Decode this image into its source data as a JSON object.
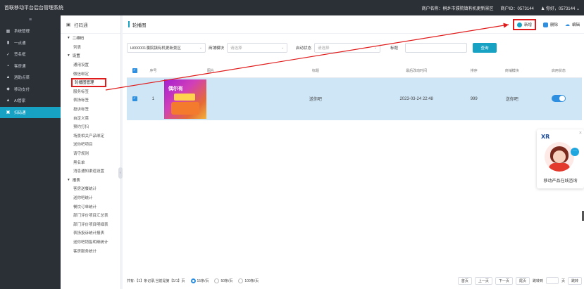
{
  "header": {
    "title": "首联移动平台后台管理系统",
    "merchant_label": "商户名称：桐乡市濮院镇有机更新景区",
    "merchant_id": "商户ID：0573144",
    "greeting": "你好，0573144"
  },
  "sidebar": {
    "toggle": "≡",
    "items": [
      {
        "icon": "grid-icon",
        "glyph": "▦",
        "label": "系统管理"
      },
      {
        "icon": "bar-chart-icon",
        "glyph": "▮",
        "label": "一点通"
      },
      {
        "icon": "pen-icon",
        "glyph": "✓",
        "label": "签名框"
      },
      {
        "icon": "cart-icon",
        "glyph": "▪",
        "label": "客房通"
      },
      {
        "icon": "shop-icon",
        "glyph": "▲",
        "label": "酒助点菜"
      },
      {
        "icon": "pay-icon",
        "glyph": "◆",
        "label": "移动支付"
      },
      {
        "icon": "home-icon",
        "glyph": "▲",
        "label": "AI管家"
      },
      {
        "icon": "scan-icon",
        "glyph": "▣",
        "label": "扫码通"
      }
    ]
  },
  "submenu": {
    "title": "扫码通",
    "groups": [
      {
        "label": "二维码",
        "items": [
          "列表"
        ]
      },
      {
        "label": "设置",
        "items": [
          "通用设置",
          "微信绑定",
          "轮播图管理",
          "服务标签",
          "表扬标签",
          "投诉标签",
          "自定义菜",
          "预约打扫",
          "场景相关产品绑定",
          "送你吧项目",
          "请守规则",
          "黑名单",
          "消息通知渠道设置"
        ]
      },
      {
        "label": "报表",
        "items": [
          "客房送餐统计",
          "送你吧统计",
          "餐饮订单统计",
          "部门评价项目汇总表",
          "部门评价项目明细表",
          "表扬投诉统计报表",
          "送你吧销售明细统计",
          "客房服务统计"
        ]
      }
    ],
    "collapse_glyph": "‹"
  },
  "content": {
    "page_title": "轮播图",
    "toolbar": {
      "new_label": "新增",
      "delete_label": "删除",
      "edit_label": "编辑"
    },
    "filters": {
      "merchant_value": "H000001濮院镇有机更新景区",
      "module_label": "商铺模块",
      "module_placeholder": "请选择",
      "status_label": "启动状态",
      "status_placeholder": "请选择",
      "title_label": "标题",
      "query_label": "查询"
    },
    "table": {
      "headers": [
        "",
        "序号",
        "图片",
        "标题",
        "最后改动时间",
        "排序",
        "商铺模块",
        "启用状态"
      ],
      "rows": [
        {
          "checked": "✓",
          "index": "1",
          "thumb_text": "偶尔有",
          "title": "送你吧",
          "modified": "2023-03-24 22:48",
          "sort": "999",
          "module": "送你吧",
          "enabled": true
        }
      ]
    },
    "pager": {
      "summary": "共有:【1】条记录,当前是第【1/1】页",
      "options": [
        "15条/页",
        "50条/页",
        "100条/页"
      ],
      "first": "首页",
      "prev": "上一页",
      "next": "下一页",
      "last": "尾页",
      "jump_label": "跳转到",
      "page_label": "页",
      "go_label": "跳转"
    }
  },
  "widget": {
    "logo": "XR",
    "close": "×",
    "bubble": "···",
    "label": "移动产品在线咨询"
  },
  "colors": {
    "accent": "#17a2c4",
    "sidebar_bg": "#2b2f36",
    "highlight": "#e01b1b",
    "row_selected": "#cfe6f7",
    "toggle_on": "#2e8fe0"
  }
}
